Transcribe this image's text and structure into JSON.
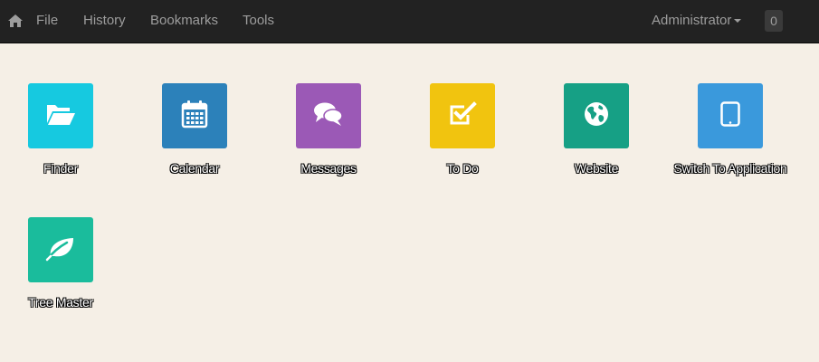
{
  "nav": {
    "home_icon": "home-icon",
    "menu": [
      "File",
      "History",
      "Bookmarks",
      "Tools"
    ],
    "user": "Administrator",
    "badge": "0"
  },
  "apps": [
    {
      "label": "Finder",
      "icon": "folder-open-icon",
      "color": "#16c9e0"
    },
    {
      "label": "Calendar",
      "icon": "calendar-icon",
      "color": "#2c81ba"
    },
    {
      "label": "Messages",
      "icon": "chat-bubbles-icon",
      "color": "#9b59b6"
    },
    {
      "label": "To Do",
      "icon": "checkbox-icon",
      "color": "#f1c40f"
    },
    {
      "label": "Website",
      "icon": "globe-icon",
      "color": "#16a085"
    },
    {
      "label": "Switch To Application",
      "icon": "tablet-icon",
      "color": "#3a99dc"
    },
    {
      "label": "Tree Master",
      "icon": "leaf-icon",
      "color": "#1abc9c"
    }
  ]
}
